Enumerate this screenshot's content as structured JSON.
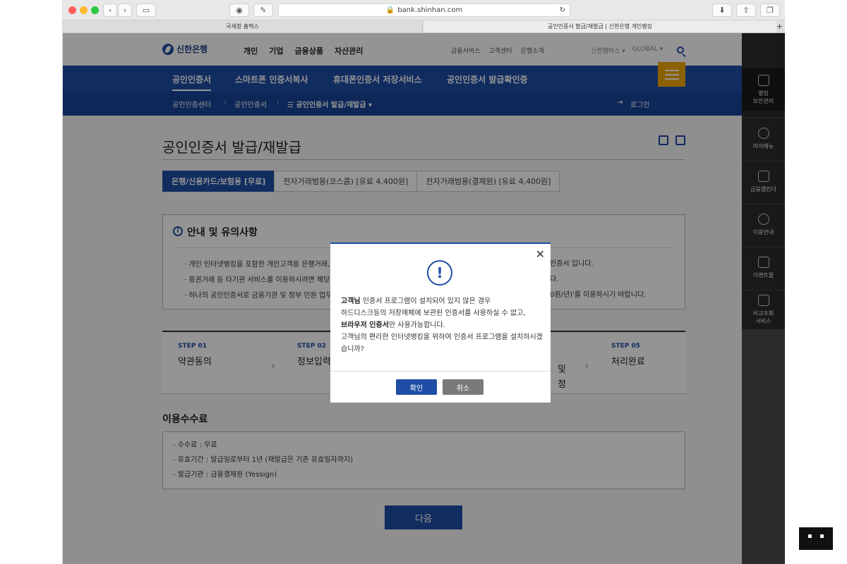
{
  "browser": {
    "url": "bank.shinhan.com",
    "tabs": [
      "국세청 홈택스",
      "공인인증서 발급/재발급 | 신한은행 개인뱅킹"
    ]
  },
  "header": {
    "logo": "신한은행",
    "main_nav": [
      "개인",
      "기업",
      "금융상품",
      "자산관리"
    ],
    "util_nav": [
      "금융서비스",
      "고객센터",
      "은행소개"
    ],
    "family": "신한멤버스 ▾",
    "global": "GLOBAL ▾"
  },
  "subnav": [
    "공인인증서",
    "스마트폰 인증서복사",
    "휴대폰인증서 저장서비스",
    "공인인증서 발급확인증"
  ],
  "breadcrumb": {
    "items": [
      "공인인증센터",
      "공인인증서",
      "☰ 공인인증서 발급/재발급 ▾"
    ],
    "login": "로그인"
  },
  "page": {
    "title": "공인인증서 발급/재발급",
    "tabs": [
      "은행/신용카드/보험용 [무료]",
      "전자거래범용(코스콤) [유료 4,400원]",
      "전자거래범용(결제원) [유료 4,400원]"
    ],
    "notice_title": "안내 및 유의사항",
    "notice_items": [
      "개인 인터넷뱅킹을 포함한 개인고객용 은행거래,",
      "증권거래 등 타기관 서비스를 이용하시려면 해당",
      "하나의 공인인증서로 금융기관 및 정부 민원 업무"
    ],
    "notice_tails": [
      "인증서 입니다.",
      "다.",
      "0원/년)'를 이용하시기 바랍니다."
    ],
    "steps": [
      {
        "num": "STEP 01",
        "label": "약관동의"
      },
      {
        "num": "STEP 02",
        "label": "정보입력"
      },
      {
        "num": "",
        "label": "및"
      },
      {
        "num": "",
        "label": "정"
      },
      {
        "num": "STEP 05",
        "label": "처리완료"
      }
    ],
    "fee_title": "이용수수료",
    "fee_items": [
      "- 수수료 : 무료",
      "- 유효기간 : 발급일로부터 1년 (재발급은 기존 유효일자까지)",
      "- 발급기관 : 금융결제원 (Yessign)"
    ],
    "next_button": "다음"
  },
  "sidebar": [
    {
      "label": "뱅킹\n보안관리"
    },
    {
      "label": "마이메뉴"
    },
    {
      "label": "금융캘린더"
    },
    {
      "label": "이용안내"
    },
    {
      "label": "이벤트몰"
    },
    {
      "label": "비교조회\n서비스"
    }
  ],
  "modal": {
    "close": "✕",
    "icon": "!",
    "line1_bold": "고객님",
    "line1_rest": " 인증서 프로그램이 설치되어 있지 않은 경우",
    "line2": "하드디스크등의 저장매체에 보관된 인증서를 사용하실 수 없고,",
    "line3_bold": "브라우저 인증서",
    "line3_rest": "만 사용가능합니다.",
    "line4": "고객님의 편리한 인터넷뱅킹을 위하여 인증서 프로그램을 설치하시겠습니까?",
    "ok": "확인",
    "cancel": "취소"
  },
  "colors": {
    "brand": "#1e4ea5",
    "menu": "#f0a800"
  }
}
